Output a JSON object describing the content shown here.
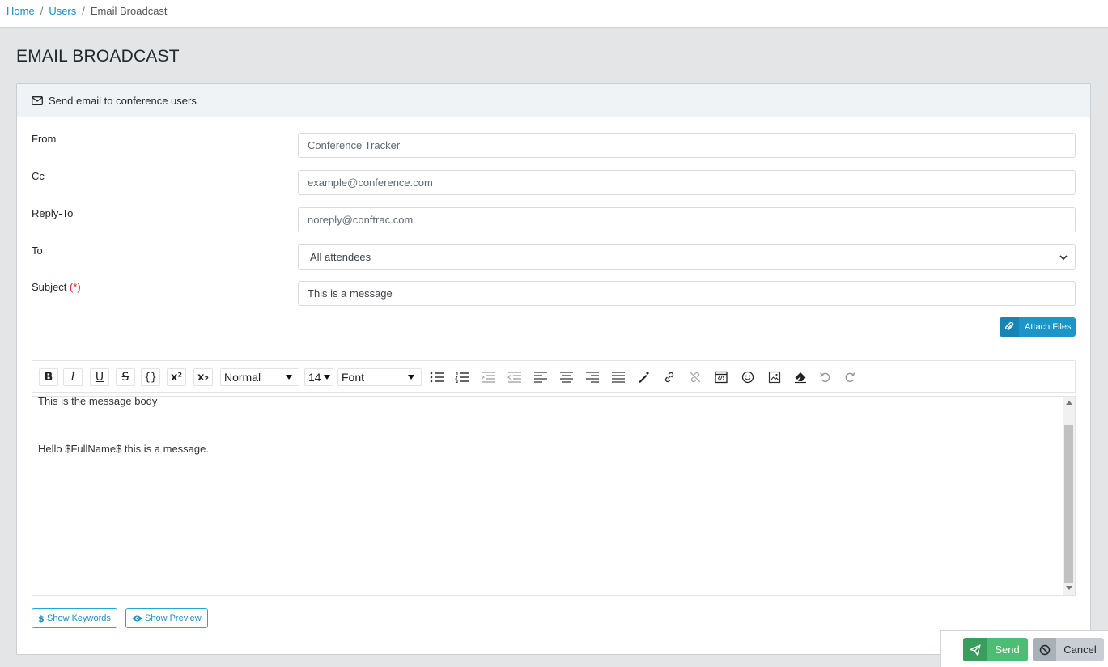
{
  "breadcrumb": {
    "home": "Home",
    "users": "Users",
    "current": "Email Broadcast"
  },
  "page": {
    "title": "EMAIL BROADCAST"
  },
  "card": {
    "header": "Send email to conference users"
  },
  "form": {
    "from_label": "From",
    "from_value": "Conference Tracker",
    "cc_label": "Cc",
    "cc_placeholder": "example@conference.com",
    "replyto_label": "Reply-To",
    "replyto_value": "noreply@conftrac.com",
    "to_label": "To",
    "to_selected": "All attendees",
    "subject_label": "Subject",
    "subject_required": "(*)",
    "subject_value": "This is a message"
  },
  "attach_label": "Attach Files",
  "toolbar": {
    "bold": "B",
    "italic": "I",
    "underline": "U",
    "strike": "S",
    "code": "{}",
    "superscript": "x²",
    "subscript": "x₂",
    "style_select": "Normal",
    "size_select": "14",
    "font_select": "Font"
  },
  "editor": {
    "line1": "This is the message body",
    "line2": "Hello $FullName$ this is a message."
  },
  "buttons": {
    "show_keywords": "Show Keywords",
    "show_preview": "Show Preview",
    "send": "Send",
    "cancel": "Cancel"
  },
  "colors": {
    "primary": "#20a8d8",
    "success": "#4dbd74",
    "secondary": "#c8ced3",
    "required": "#e02424",
    "link": "#1a8ac4"
  }
}
